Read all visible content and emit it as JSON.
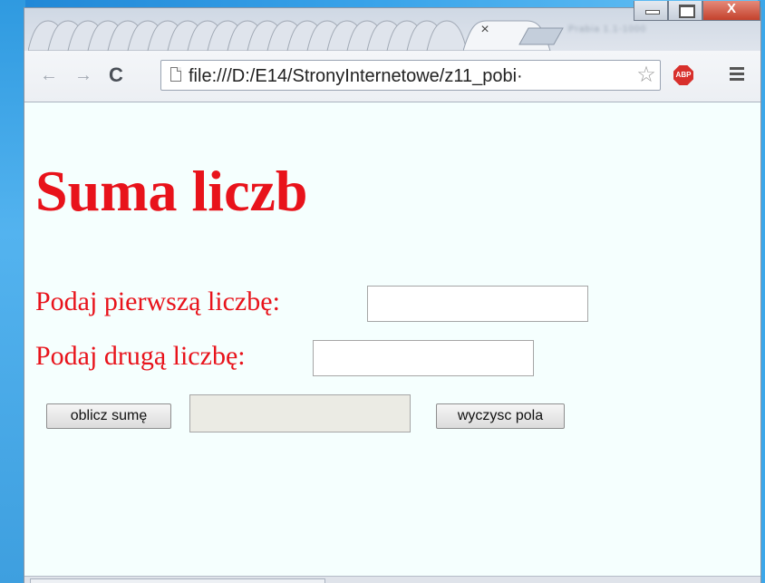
{
  "browser": {
    "tab_close_label": "×",
    "blurred_tab_text": "Prabia  1.1-1000",
    "window_controls": {
      "minimize_icon": "minimize-icon",
      "maximize_icon": "maximize-icon",
      "close_label": "X"
    },
    "toolbar": {
      "back_icon": "←",
      "forward_icon": "→",
      "reload_icon": "C",
      "url": "file:///D:/E14/StronyInternetowe/z11_pobi·",
      "star_icon": "☆",
      "abp_label": "ABP"
    }
  },
  "page": {
    "title": "Suma liczb",
    "first_label": "Podaj pierwszą liczbę:",
    "first_value": "",
    "second_label": "Podaj drugą liczbę:",
    "second_value": "",
    "sum_button": "oblicz sumę",
    "result_value": "",
    "clear_button": "wyczysc pola"
  },
  "colors": {
    "heading_red": "#e8131b",
    "page_background": "#f5fffe",
    "result_field_background": "#ebebe4"
  }
}
